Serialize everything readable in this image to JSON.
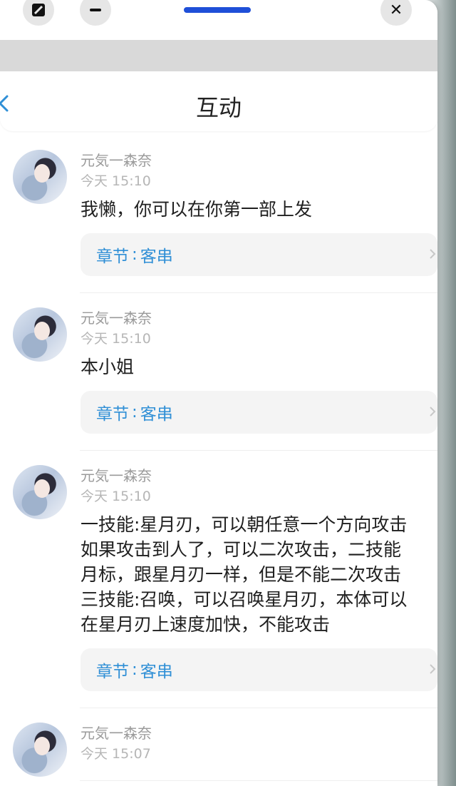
{
  "window": {
    "controls": {
      "left1_icon": "resize-icon",
      "left2_icon": "minimize-icon",
      "right_icon": "close-icon",
      "close_glyph": "✕"
    }
  },
  "header": {
    "title": "互动",
    "back_icon": "back-chevron-icon"
  },
  "comments": [
    {
      "user": "元気一森奈",
      "time": "今天 15:10",
      "text": "我懒，你可以在你第一部上发",
      "chapter_label": "章节",
      "chapter_sep": ":",
      "chapter_name": "客串"
    },
    {
      "user": "元気一森奈",
      "time": "今天 15:10",
      "text": "本小姐",
      "chapter_label": "章节",
      "chapter_sep": ":",
      "chapter_name": "客串"
    },
    {
      "user": "元気一森奈",
      "time": "今天 15:10",
      "text": "一技能:星月刃，可以朝任意一个方向攻击\n如果攻击到人了，可以二次攻击，二技能\n月标，跟星月刃一样，但是不能二次攻击\n三技能:召唤，可以召唤星月刃，本体可以\n在星月刃上速度加快，不能攻击",
      "chapter_label": "章节",
      "chapter_sep": ":",
      "chapter_name": "客串"
    },
    {
      "user": "元気一森奈",
      "time": "今天 15:07"
    }
  ],
  "colors": {
    "accent": "#2f8fd6",
    "handle": "#1f4fd8"
  }
}
